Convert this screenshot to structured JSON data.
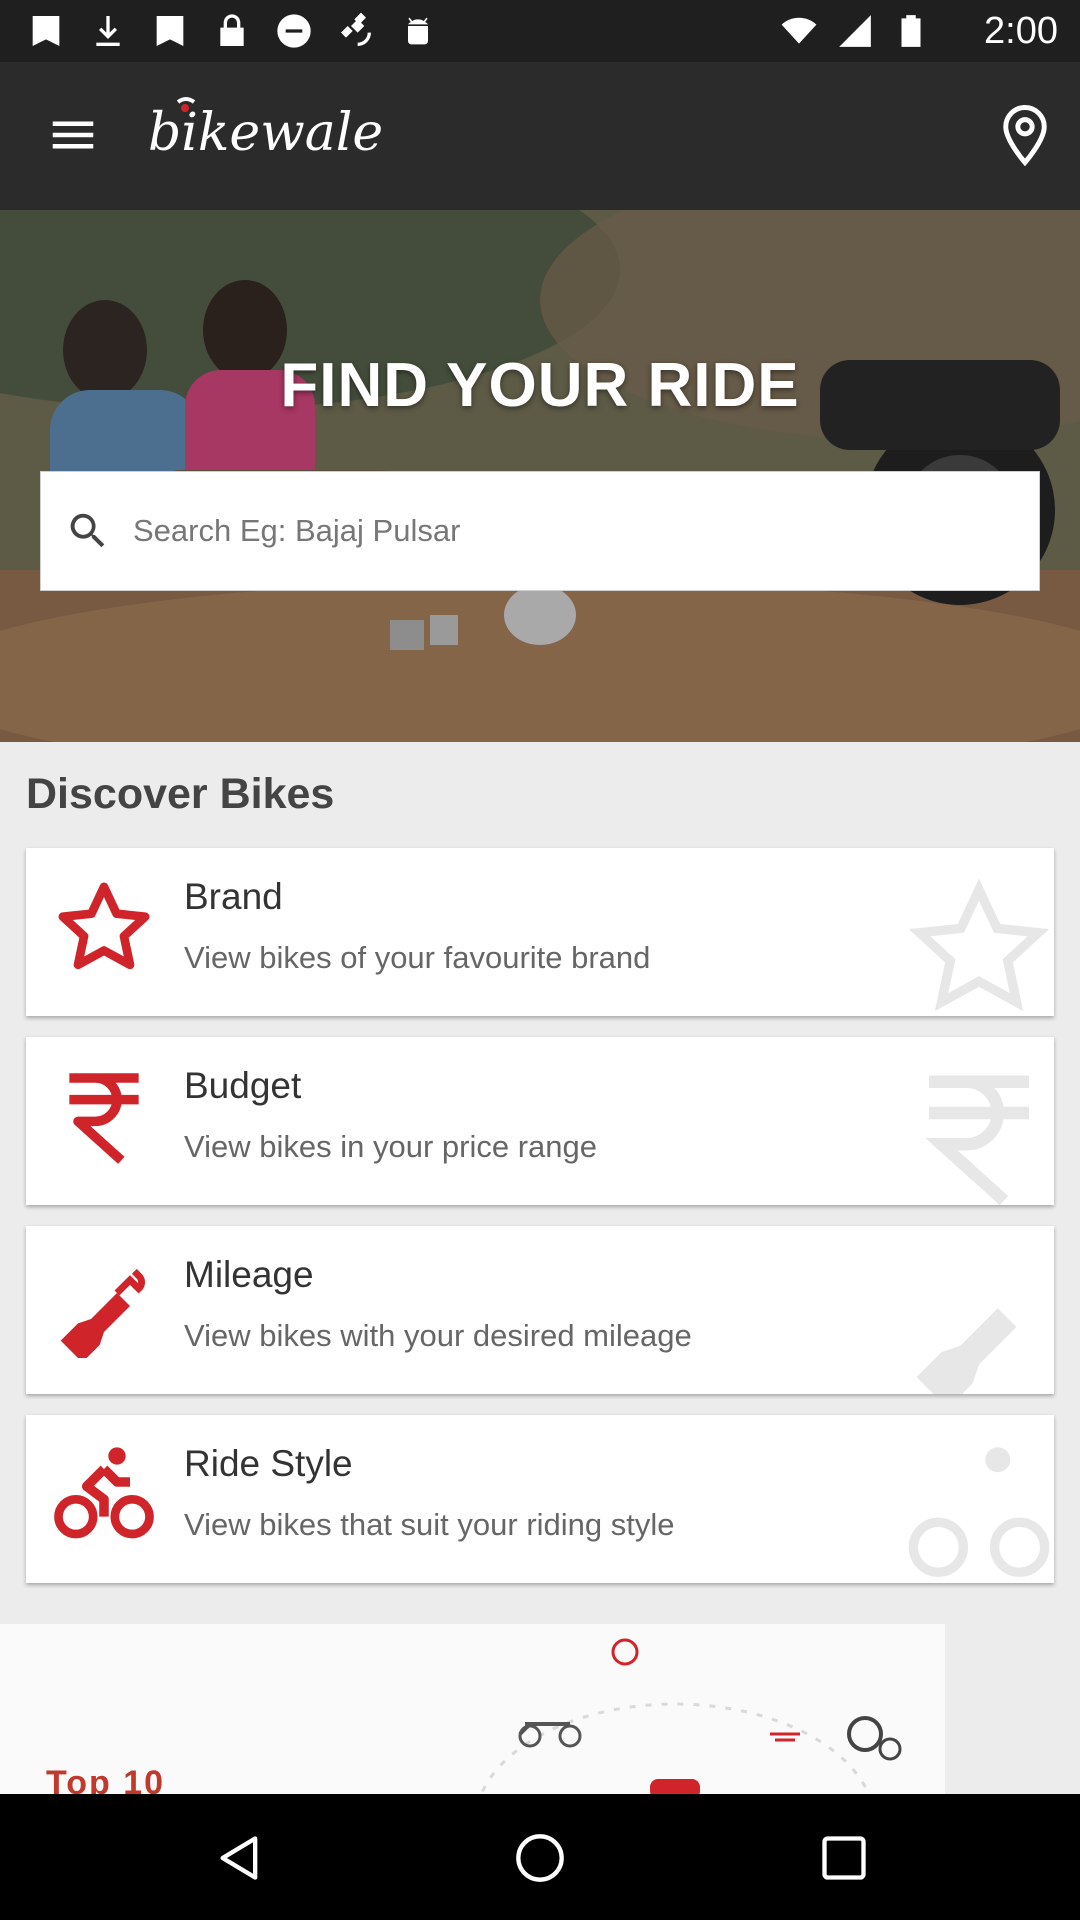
{
  "status_bar": {
    "time": "2:00",
    "left_icons": [
      "image-icon",
      "download-icon",
      "image-icon",
      "lock-icon",
      "do-not-disturb-icon",
      "satellite-icon",
      "android-icon"
    ],
    "right_icons": [
      "wifi-icon",
      "signal-icon",
      "battery-icon"
    ]
  },
  "app_bar": {
    "logo_text": "bikewale",
    "menu_icon": "hamburger-icon",
    "location_icon": "location-pin-icon"
  },
  "hero": {
    "title": "FIND YOUR RIDE",
    "search_placeholder": "Search Eg: Bajaj Pulsar"
  },
  "discover": {
    "heading": "Discover Bikes",
    "items": [
      {
        "title": "Brand",
        "subtitle": "View bikes of your favourite brand",
        "icon": "star-icon"
      },
      {
        "title": "Budget",
        "subtitle": "View bikes in your price range",
        "icon": "rupee-icon"
      },
      {
        "title": "Mileage",
        "subtitle": "View bikes with your desired mileage",
        "icon": "fuel-nozzle-icon"
      },
      {
        "title": "Ride Style",
        "subtitle": "View bikes that suit your riding style",
        "icon": "cyclist-icon"
      }
    ]
  },
  "promo": {
    "text": "Top 10"
  },
  "colors": {
    "accent_red": "#d0242b",
    "app_bar": "#2b2b2b",
    "status_bar": "#1f1f1f"
  }
}
